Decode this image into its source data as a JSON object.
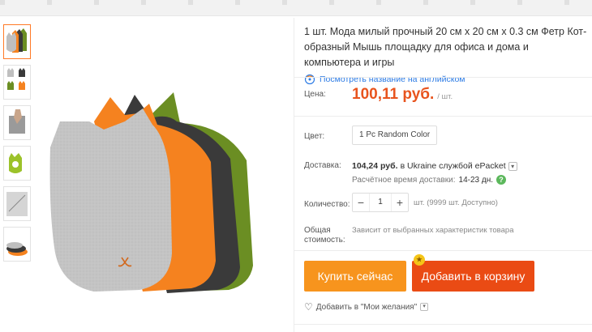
{
  "product": {
    "title": "1 шт. Мода милый прочный 20 см x 20 см x 0.3 см Фетр Кот-образный Мышь площадку для офиса и дома и компьютера и игры",
    "translate_link": "Посмотреть название на английском"
  },
  "price": {
    "label": "Цена:",
    "value": "100,11 руб.",
    "unit": "/ шт."
  },
  "color": {
    "label": "Цвет:",
    "selected": "1 Pc Random Color"
  },
  "shipping": {
    "label": "Доставка:",
    "price": "104,24 руб.",
    "text": "в Ukraine службой ePacket",
    "time_label": "Расчётное время доставки:",
    "time_value": "14-23 дн."
  },
  "quantity": {
    "label": "Количество:",
    "value": "1",
    "minus": "−",
    "plus": "+",
    "availability": "шт. (9999 шт. Доступно)"
  },
  "total": {
    "label": "Общая стоимость:",
    "note": "Зависит от выбранных характеристик товара"
  },
  "actions": {
    "buy_now": "Купить сейчас",
    "add_to_cart": "Добавить в корзину",
    "wishlist": "Добавить в \"Мои желания\""
  },
  "icons": {
    "translate": "globe-refresh-icon",
    "help": "question-icon",
    "wishlist": "heart-plus-icon",
    "dropdown": "chevron-down-icon"
  },
  "colors": {
    "price": "#e8541e",
    "buy_button": "#f7941d",
    "cart_button": "#ea4b14",
    "link": "#2c7be5",
    "felt_gray": "#bfbfbf",
    "felt_orange": "#f5821f",
    "felt_dark": "#3a3a3a",
    "felt_green": "#6b8e23"
  }
}
